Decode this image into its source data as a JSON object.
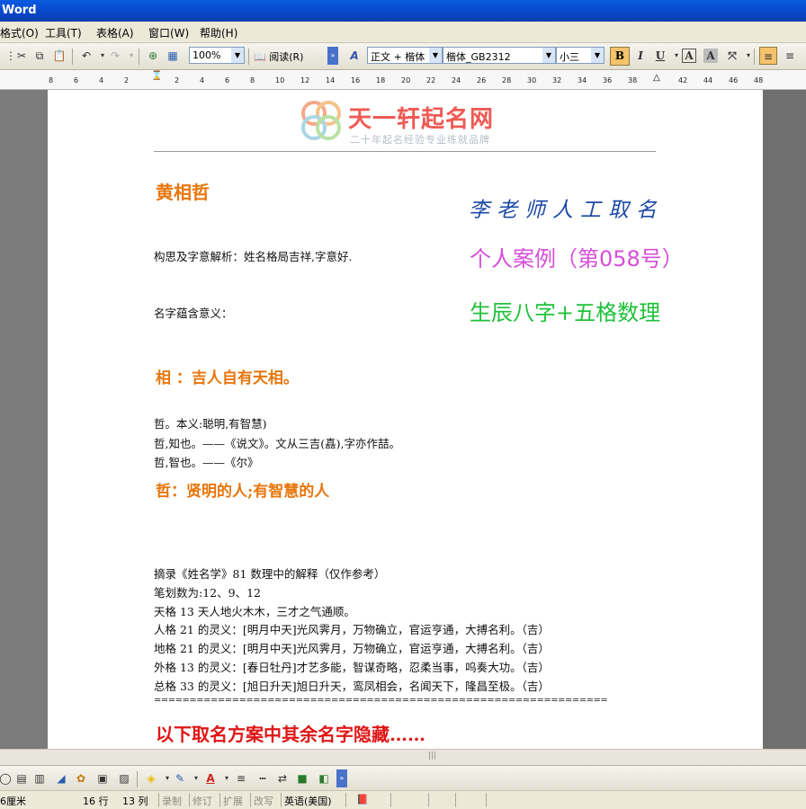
{
  "window": {
    "title": "Word"
  },
  "menu": {
    "items": [
      "格式(O)",
      "工具(T)",
      "表格(A)",
      "窗口(W)",
      "帮助(H)"
    ]
  },
  "toolbar": {
    "zoom": "100%",
    "read_label": "阅读(R)",
    "style": "正文 + 楷体",
    "font": "楷体_GB2312",
    "size": "小三",
    "bold": "B",
    "italic": "I",
    "underline": "U",
    "char_border": "A",
    "char_shade": "A"
  },
  "ruler": {
    "ticks": [
      "8",
      "6",
      "4",
      "2",
      "",
      "2",
      "4",
      "6",
      "8",
      "10",
      "12",
      "14",
      "16",
      "18",
      "20",
      "22",
      "24",
      "26",
      "28",
      "30",
      "32",
      "34",
      "36",
      "38",
      "",
      "42",
      "44",
      "46",
      "48"
    ]
  },
  "logo": {
    "brand": "天一轩起名网",
    "slogan": "二十年起名经验专业练就品牌"
  },
  "document": {
    "name": "黄相哲",
    "signature": "李老师人工取名",
    "case_label": "个人案例（第058号）",
    "bazi_label": "生辰八字+五格数理",
    "analysis": "构思及字意解析：姓名格局吉祥,字意好.",
    "meaning_label": "名字蕴含意义：",
    "char1_title": "相 ：吉人自有天相。",
    "lines_zhe": [
      "哲。本义:聪明,有智慧)",
      "哲,知也。——《说文》。文从三吉(嚞),字亦作喆。",
      "哲,智也。——《尔》"
    ],
    "char2_title": "哲：贤明的人;有智慧的人",
    "numerology": [
      "摘录《姓名学》81 数理中的解释（仅作参考）",
      "笔划数为:12、9、12",
      "天格 13 天人地火木木，三才之气通顺。",
      "人格 21 的灵义：[明月中天]光风霁月，万物确立，官运亨通，大搏名利。（吉）",
      "地格 21 的灵义：[明月中天]光风霁月，万物确立，官运亨通，大搏名利。（吉）",
      "外格 13 的灵义：[春日牡丹]才艺多能，智谋奇略，忍柔当事，呜奏大功。（吉）",
      "总格 33 的灵义：[旭日升天]旭日升天，鸾凤相会，名闻天下，隆昌至极。（吉）"
    ],
    "divider": "================================================================",
    "hidden_notice": "以下取名方案中其余名字隐藏……"
  },
  "status": {
    "position": "6厘米",
    "line": "16 行",
    "col": "13 列",
    "rec": "录制",
    "trk": "修订",
    "ext": "扩展",
    "ovr": "改写",
    "lang": "英语(美国)"
  },
  "colors": {
    "title_orange": "#e8760c",
    "signature_blue": "#1c4aa6",
    "case_magenta": "#d64fd9",
    "bazi_green": "#1fc13a",
    "notice_red": "#e01515"
  }
}
